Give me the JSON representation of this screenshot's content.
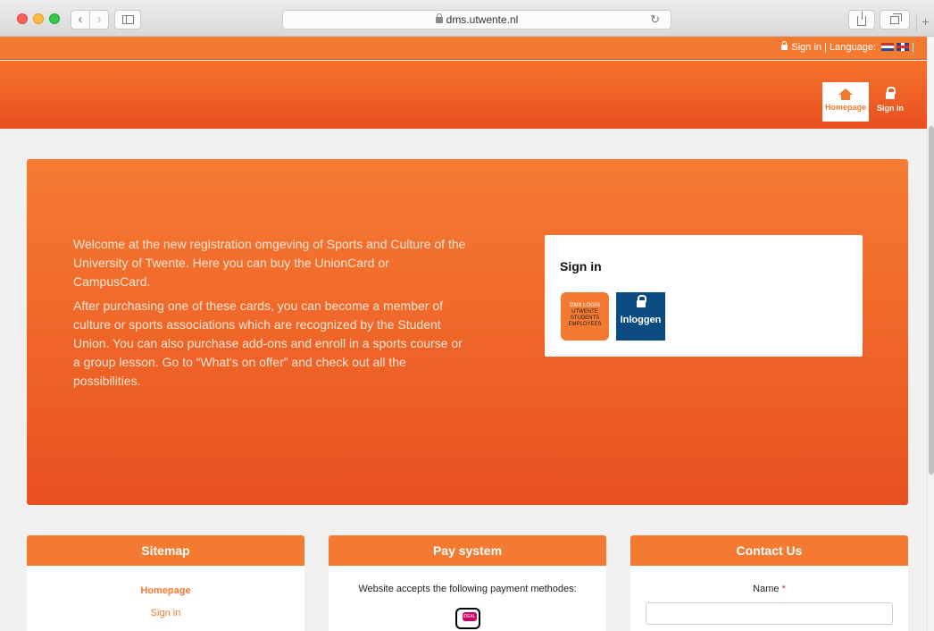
{
  "browser": {
    "url": "dms.utwente.nl",
    "back_glyph": "‹",
    "forward_glyph": "›",
    "reload_glyph": "↻",
    "new_tab_glyph": "+"
  },
  "topbar": {
    "signin_label": "Sign in",
    "separator": "|",
    "language_label": "Language:",
    "trailing_separator": "|"
  },
  "nav": {
    "home_label": "Homepage",
    "signin_label": "Sign in"
  },
  "hero": {
    "paragraph1": "Welcome at the new registration omgeving of Sports and Culture of the University of Twente. Here you can buy the UnionCard or CampusCard.",
    "paragraph2": "After purchasing one of these cards, you can become a member of culture or sports associations which are recognized by the Student Union. You can also purchase add-ons and enroll in a sports course or a group lesson. Go to “What's on offer” and check out all the possibilities."
  },
  "signin_card": {
    "title": "Sign in",
    "dms_line1": "DMS LOGIN",
    "dms_line2": "UTWENTE",
    "dms_line3": "STUDENTS",
    "dms_line4": "EMPLOYEES",
    "inloggen_label": "Inloggen"
  },
  "sitemap": {
    "title": "Sitemap",
    "link1": "Homepage",
    "link2": "Sign in"
  },
  "pay": {
    "title": "Pay system",
    "text": "Website accepts the following payment methodes:"
  },
  "contact": {
    "title": "Contact Us",
    "name_label": "Name",
    "required_mark": "*",
    "name_value": ""
  },
  "colors": {
    "brand_orange": "#f47a31",
    "brand_dark_orange": "#e8511f",
    "inloggen_blue": "#0b4b82"
  },
  "icons": [
    "lock-icon",
    "home-icon",
    "nl-flag-icon",
    "uk-flag-icon",
    "ideal-icon"
  ]
}
